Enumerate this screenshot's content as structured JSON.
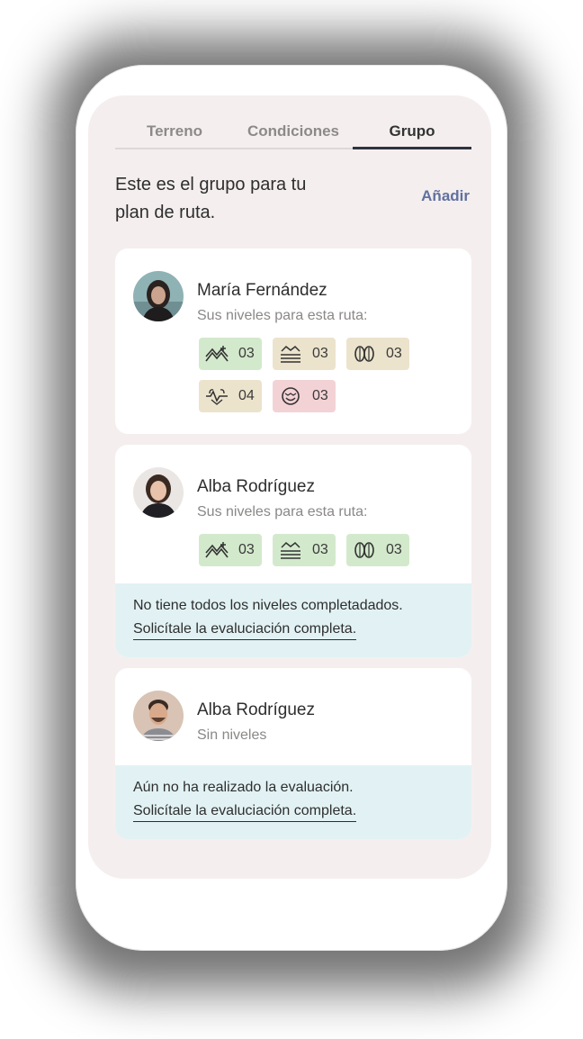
{
  "tabs": [
    {
      "label": "Terreno",
      "active": false
    },
    {
      "label": "Condiciones",
      "active": false
    },
    {
      "label": "Grupo",
      "active": true
    }
  ],
  "header": {
    "intro": "Este es el grupo para tu plan de ruta.",
    "add_label": "Añadir"
  },
  "members": [
    {
      "name": "María Fernández",
      "subtitle": "Sus niveles para esta ruta:",
      "levels": [
        {
          "icon": "mountain-sparkle-icon",
          "value": "03",
          "color": "#d3e9cc"
        },
        {
          "icon": "water-waves-icon",
          "value": "03",
          "color": "#ece3cd"
        },
        {
          "icon": "footprints-icon",
          "value": "03",
          "color": "#ece3cd"
        },
        {
          "icon": "heartbeat-icon",
          "value": "04",
          "color": "#ece3cd"
        },
        {
          "icon": "face-icon",
          "value": "03",
          "color": "#f3d2d5"
        }
      ]
    },
    {
      "name": "Alba Rodríguez",
      "subtitle": "Sus niveles para esta ruta:",
      "levels": [
        {
          "icon": "mountain-sparkle-icon",
          "value": "03",
          "color": "#d3e9cc"
        },
        {
          "icon": "water-waves-icon",
          "value": "03",
          "color": "#d3e9cc"
        },
        {
          "icon": "footprints-icon",
          "value": "03",
          "color": "#d3e9cc"
        }
      ],
      "note": "No tiene todos los niveles completadados.",
      "note_link": "Solicítale la evaluciación completa."
    },
    {
      "name": "Alba Rodríguez",
      "subtitle": "Sin niveles",
      "note": "Aún no ha realizado la evaluación.",
      "note_link": "Solicítale la evaluciación completa."
    }
  ]
}
